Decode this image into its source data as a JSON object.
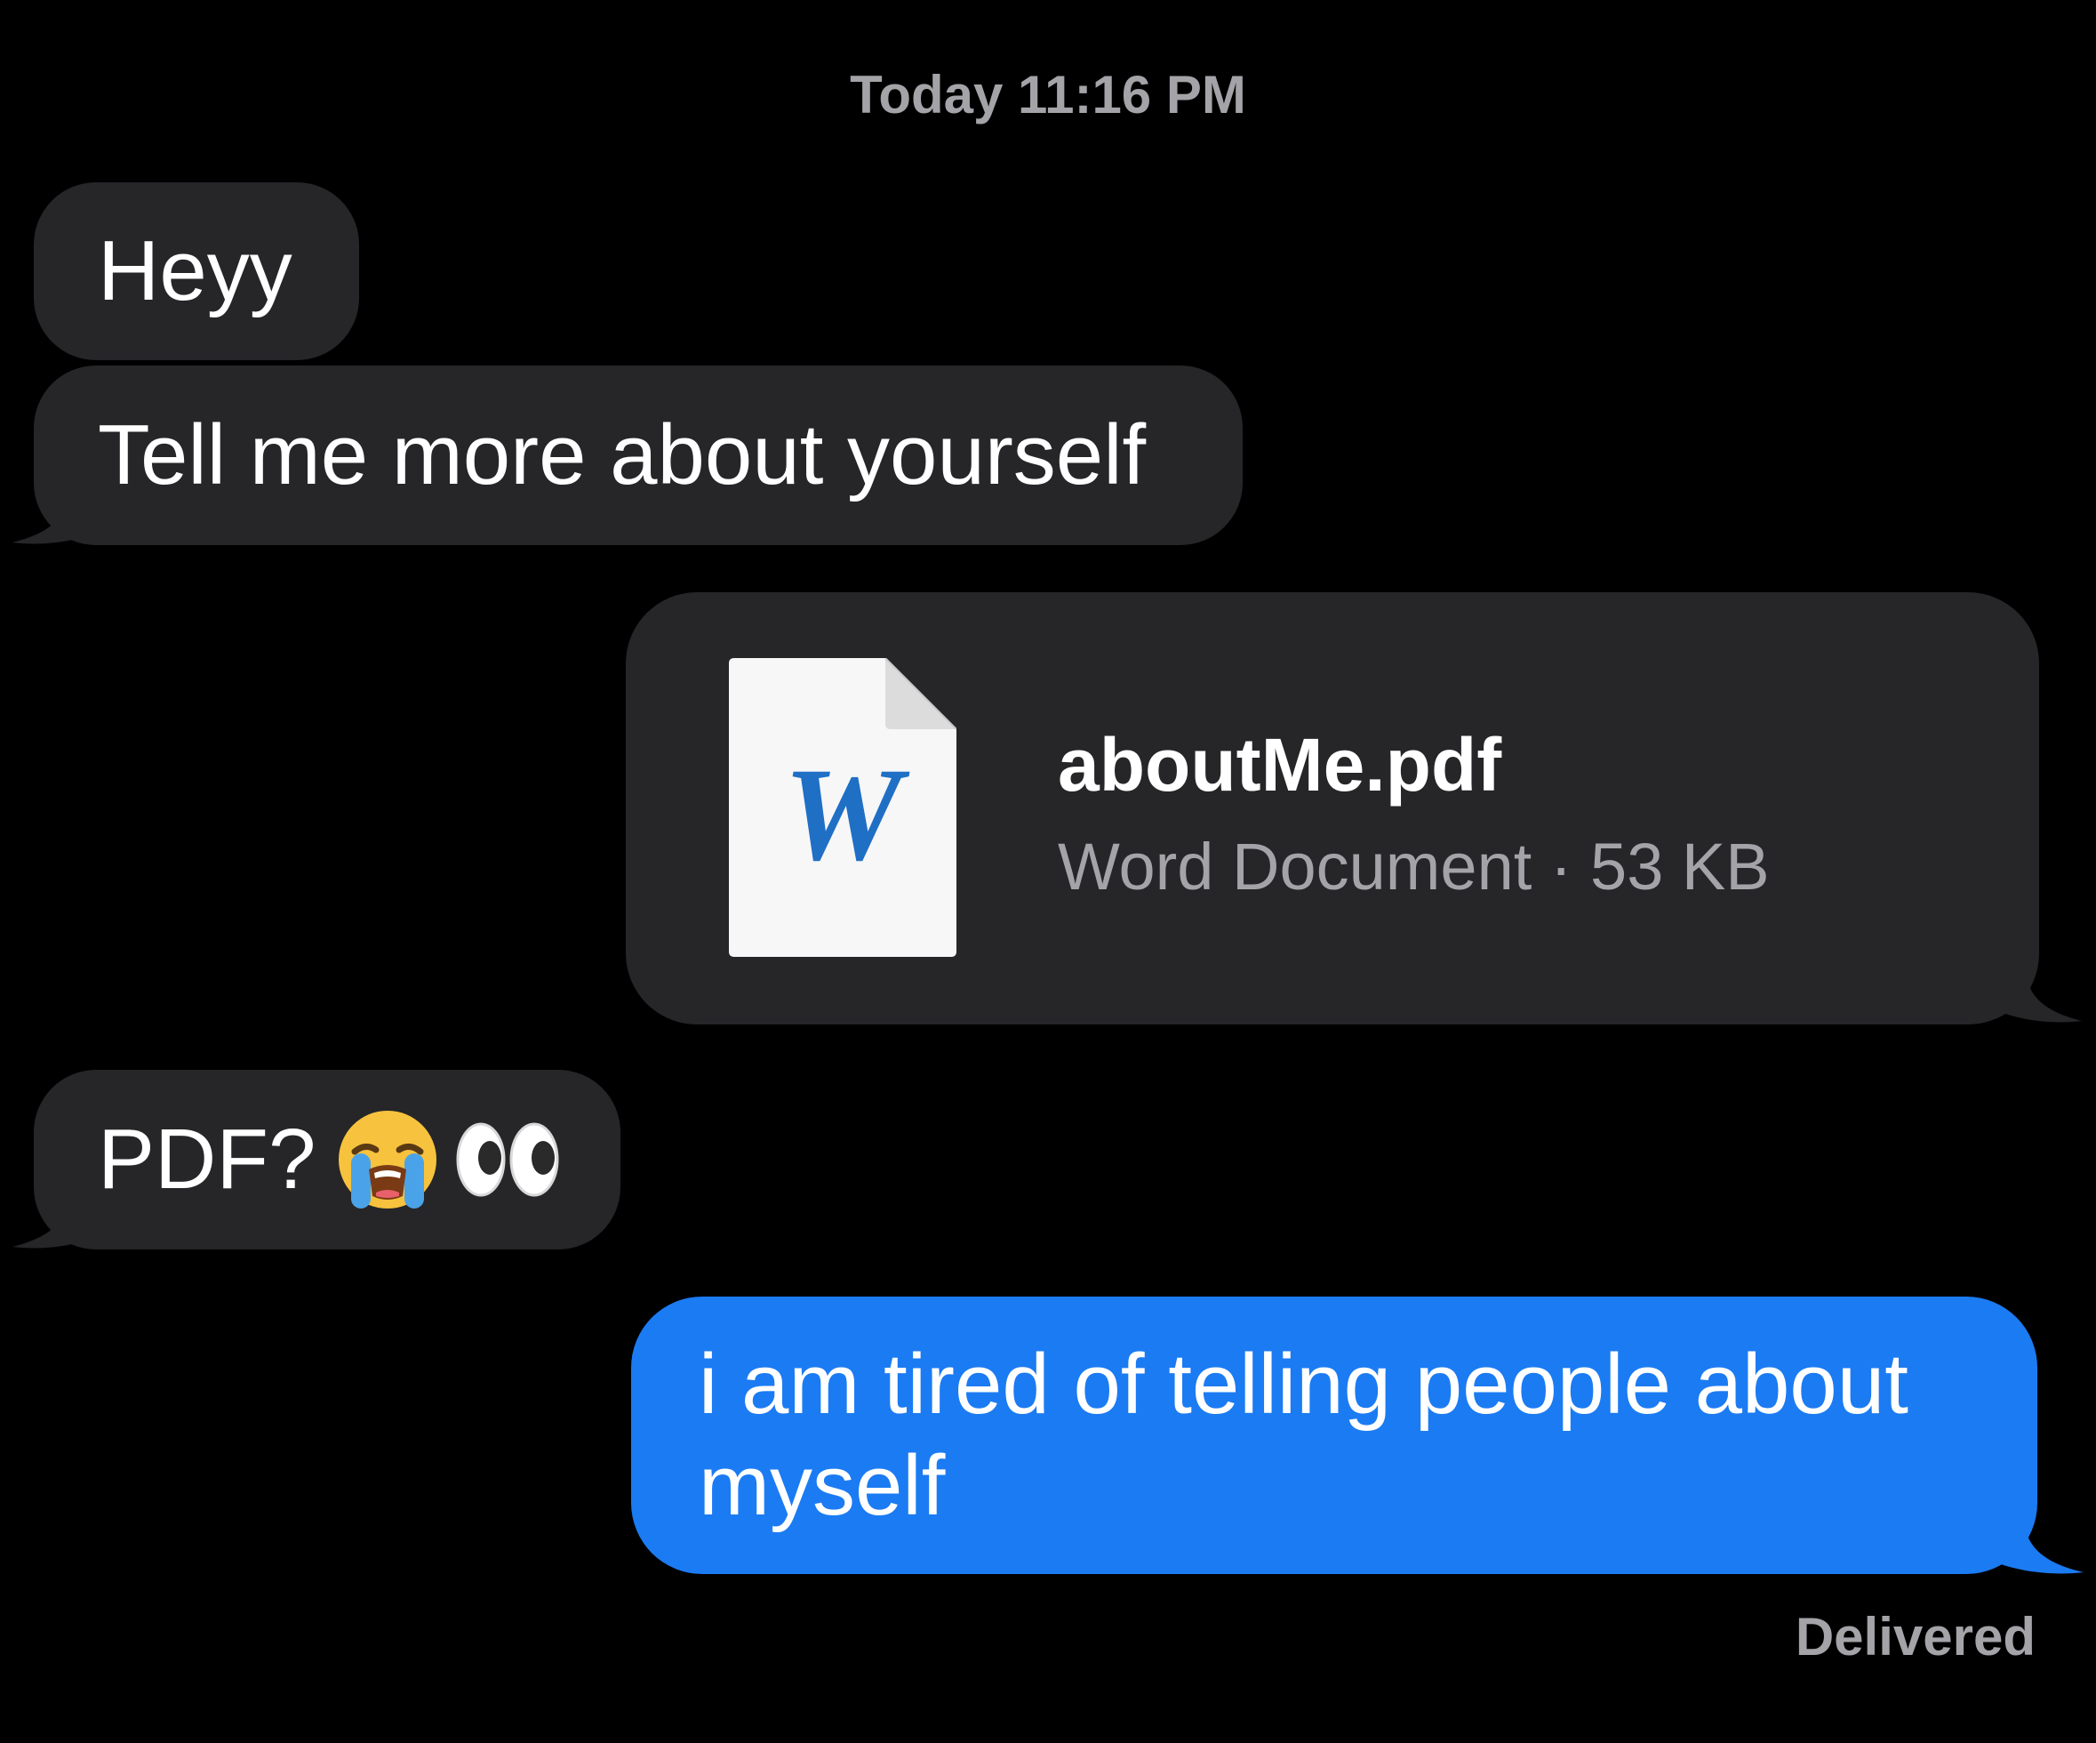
{
  "header": {
    "timestamp": "Today 11:16 PM"
  },
  "messages": [
    {
      "direction": "received",
      "text": "Heyy"
    },
    {
      "direction": "received",
      "text": "Tell me more about yourself"
    },
    {
      "direction": "sent",
      "type": "attachment",
      "file_name": "aboutMe.pdf",
      "file_meta": "Word Document · 53 KB",
      "icon": "word-document-icon",
      "icon_letter": "W"
    },
    {
      "direction": "received",
      "text": "PDF?",
      "emojis": [
        "loudly-crying-face-emoji",
        "eyes-emoji"
      ]
    },
    {
      "direction": "sent",
      "text": "i am tired of telling people about myself"
    }
  ],
  "status": {
    "delivered": "Delivered"
  },
  "colors": {
    "background": "#000000",
    "received_bubble": "#262629",
    "sent_bubble": "#1b7bf3",
    "secondary_text": "#a3a3a8",
    "word_blue": "#1f6fc5"
  }
}
